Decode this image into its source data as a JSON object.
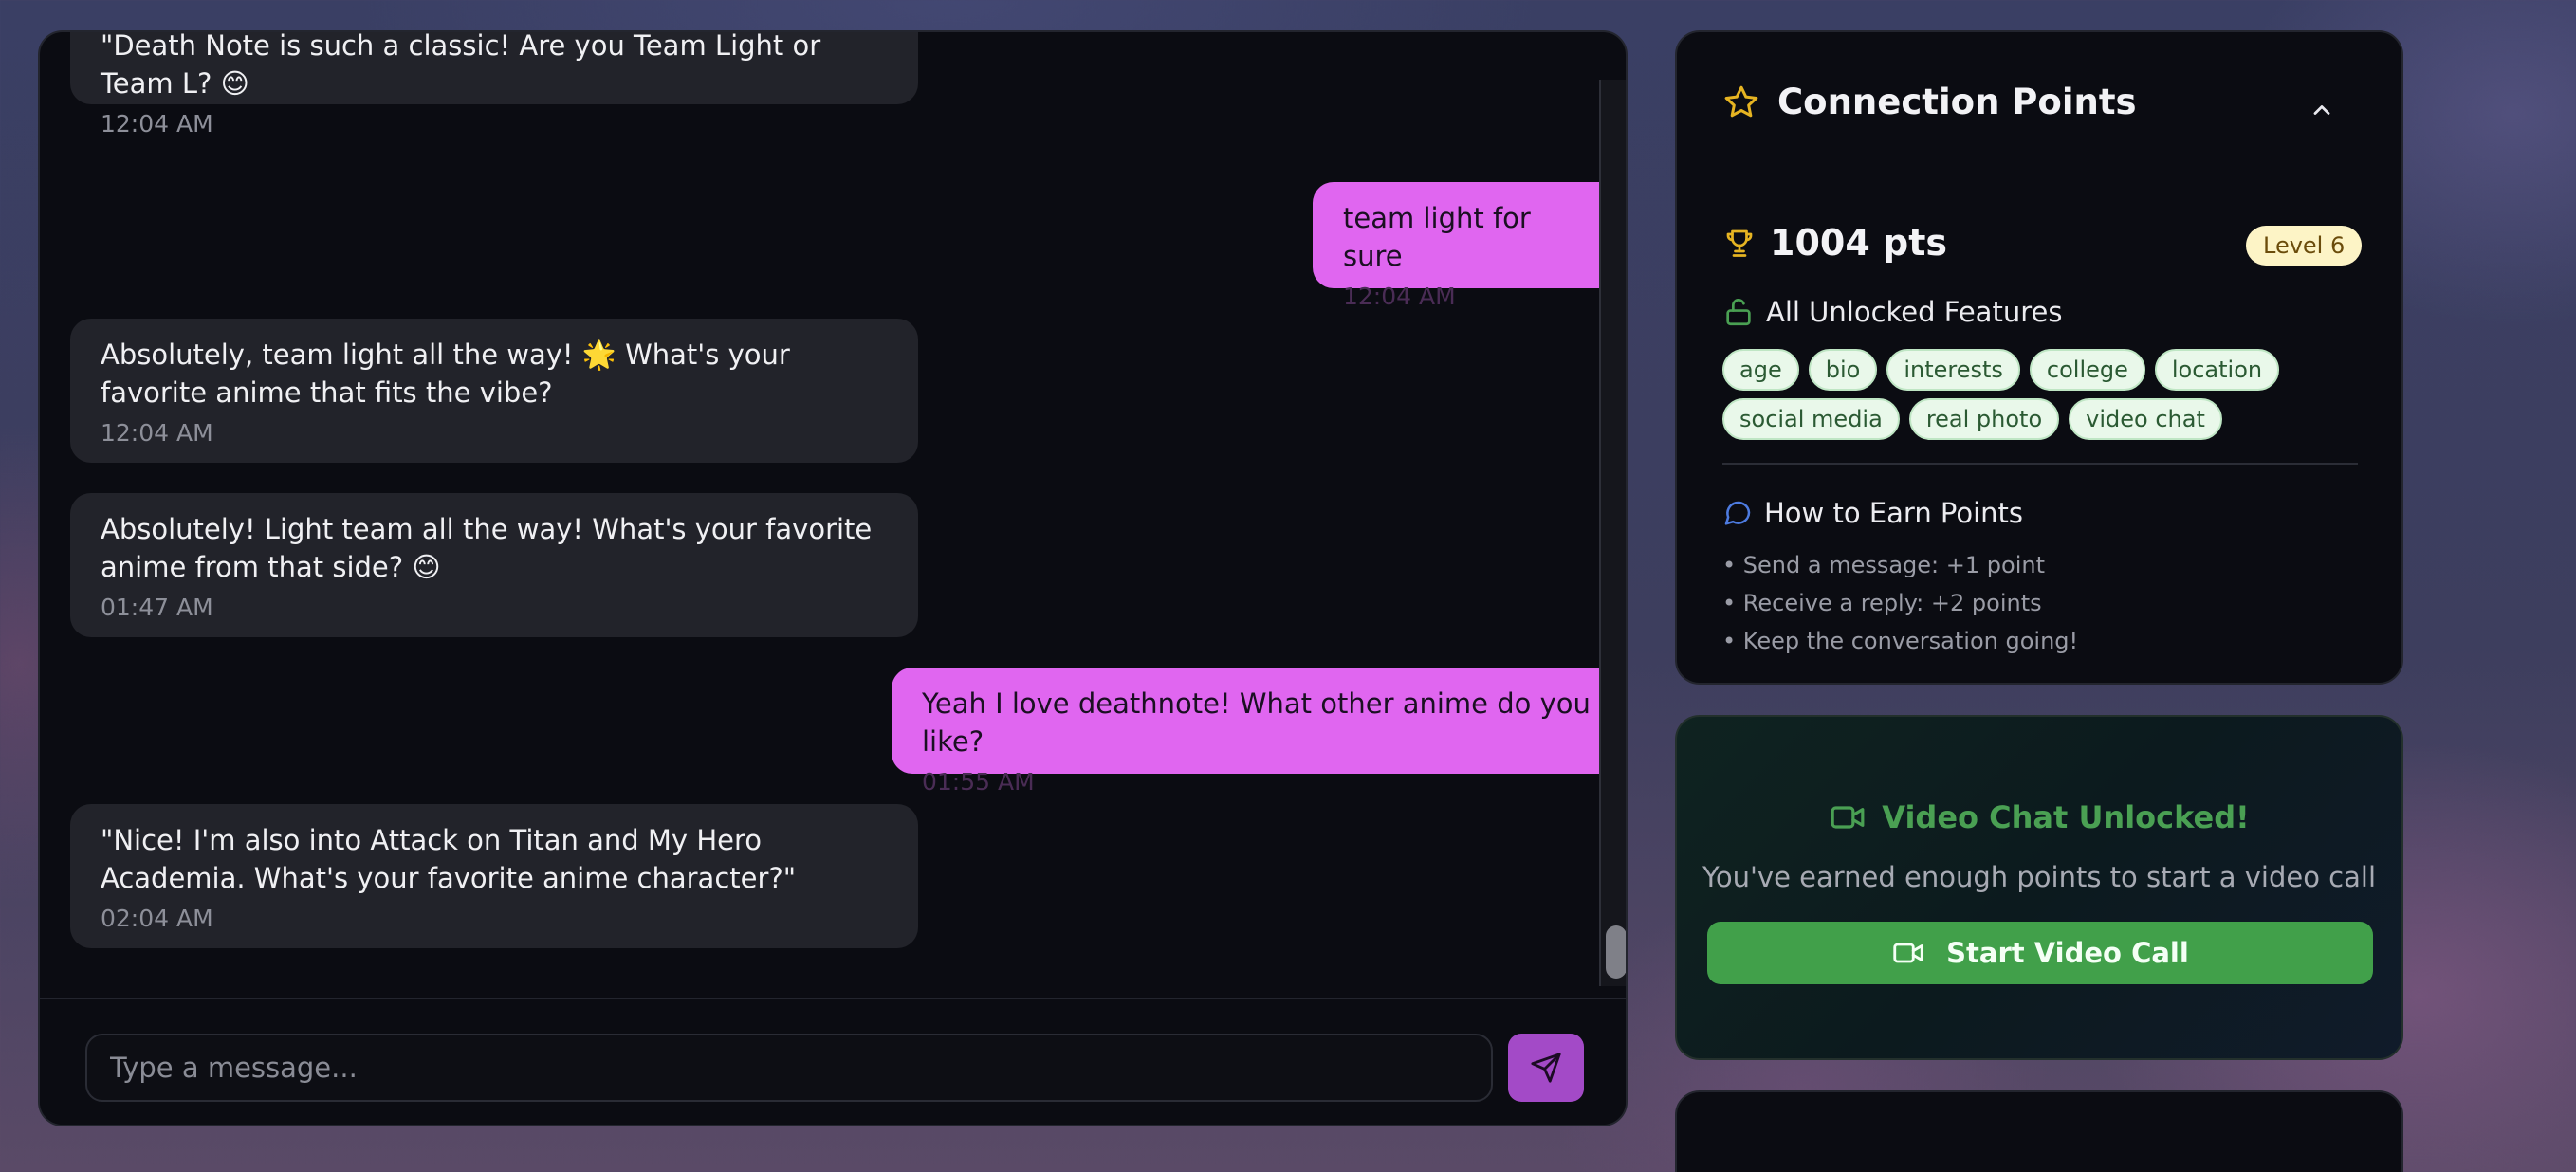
{
  "chat": {
    "messages": [
      {
        "sender": "bot",
        "text": "\"Death Note is such a classic! Are you Team Light or Team L? 😊",
        "time": "12:04 AM"
      },
      {
        "sender": "user",
        "text": "team light for sure",
        "time": "12:04 AM"
      },
      {
        "sender": "bot",
        "text": "Absolutely, team light all the way! 🌟 What's your favorite anime that fits the vibe?",
        "time": "12:04 AM"
      },
      {
        "sender": "bot",
        "text": "Absolutely! Light team all the way! What's your favorite anime from that side? 😊",
        "time": "01:47 AM"
      },
      {
        "sender": "user",
        "text": "Yeah I love deathnote! What other anime do you like?",
        "time": "01:55 AM"
      },
      {
        "sender": "bot",
        "text": "\"Nice! I'm also into Attack on Titan and My Hero Academia. What's your favorite anime character?\"",
        "time": "02:04 AM"
      }
    ],
    "input_placeholder": "Type a message...",
    "send_icon": "send-icon"
  },
  "points": {
    "title": "Connection Points",
    "title_icon": "star-icon",
    "collapse_icon": "chevron-up-icon",
    "total": "1004 pts",
    "total_icon": "trophy-icon",
    "level": "Level 6",
    "unlocked_title": "All Unlocked Features",
    "unlocked_icon": "unlock-icon",
    "features": [
      "age",
      "bio",
      "interests",
      "college",
      "location",
      "social media",
      "real photo",
      "video chat"
    ],
    "earn_title": "How to Earn Points",
    "earn_icon": "message-icon",
    "earn_rules": [
      "• Send a message: +1 point",
      "• Receive a reply: +2 points",
      "• Keep the conversation going!"
    ]
  },
  "video": {
    "title": "Video Chat Unlocked!",
    "subtitle": "You've earned enough points to start a video call",
    "button_label": "Start Video Call",
    "icon": "video-camera-icon"
  },
  "colors": {
    "user_bubble": "#e066f0",
    "bot_bubble": "#22232a",
    "accent_green": "#41a04a",
    "star_gold": "#e6b422",
    "level_badge": "#fdf4c6"
  }
}
